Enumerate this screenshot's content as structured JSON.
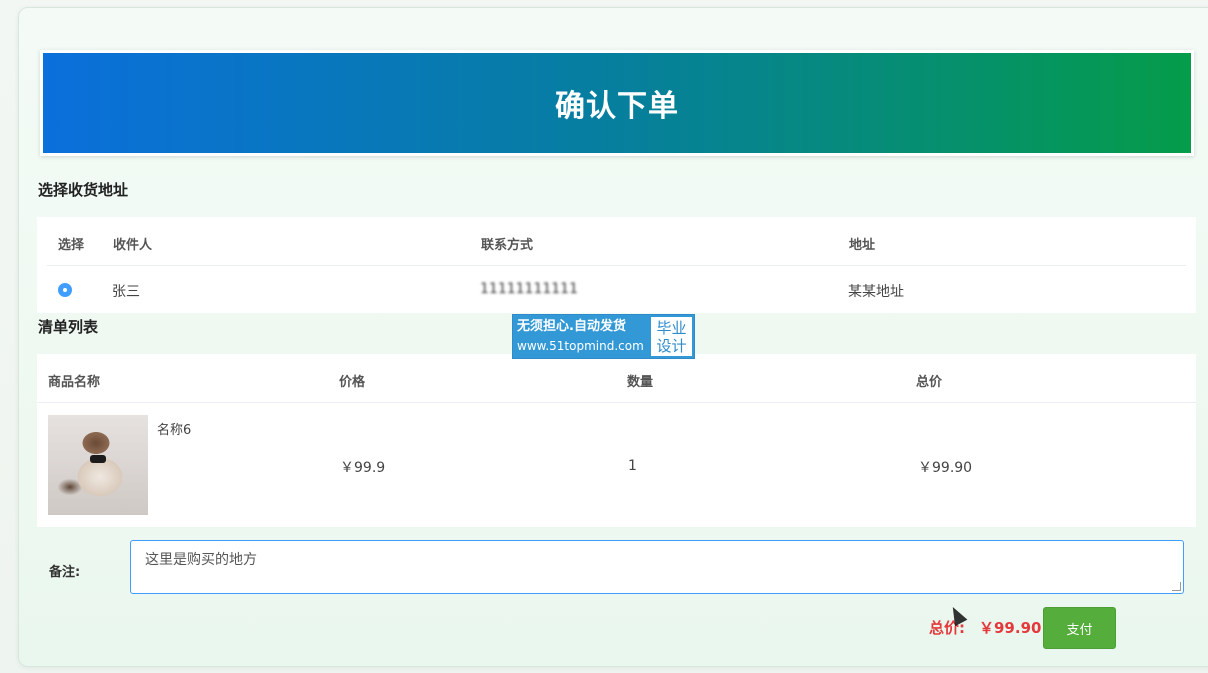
{
  "header": {
    "title": "确认下单"
  },
  "address_section": {
    "title": "选择收货地址",
    "columns": [
      "选择",
      "收件人",
      "联系方式",
      "地址"
    ],
    "rows": [
      {
        "selected": true,
        "recipient": "张三",
        "phone": "11111111111",
        "address": "某某地址"
      }
    ]
  },
  "cart_section": {
    "title": "清单列表",
    "columns": [
      "商品名称",
      "价格",
      "数量",
      "总价"
    ],
    "rows": [
      {
        "name": "名称6",
        "price": "￥99.9",
        "quantity": "1",
        "subtotal": "￥99.90"
      }
    ]
  },
  "watermark": {
    "line1": "无须担心.自动发货",
    "line2": "www.51topmind.com",
    "side1": "毕业",
    "side2": "设计"
  },
  "remark": {
    "label": "备注:",
    "value": "这里是购买的地方"
  },
  "footer": {
    "total_label": "总价:",
    "total_value": "￥99.90",
    "pay_label": "支付"
  },
  "colors": {
    "accent": "#409eff",
    "price_red": "#e4393c",
    "pay_green": "#55ad3b"
  },
  "icons": {
    "radio": "radio-selected-icon",
    "cursor": "mouse-cursor-icon"
  }
}
